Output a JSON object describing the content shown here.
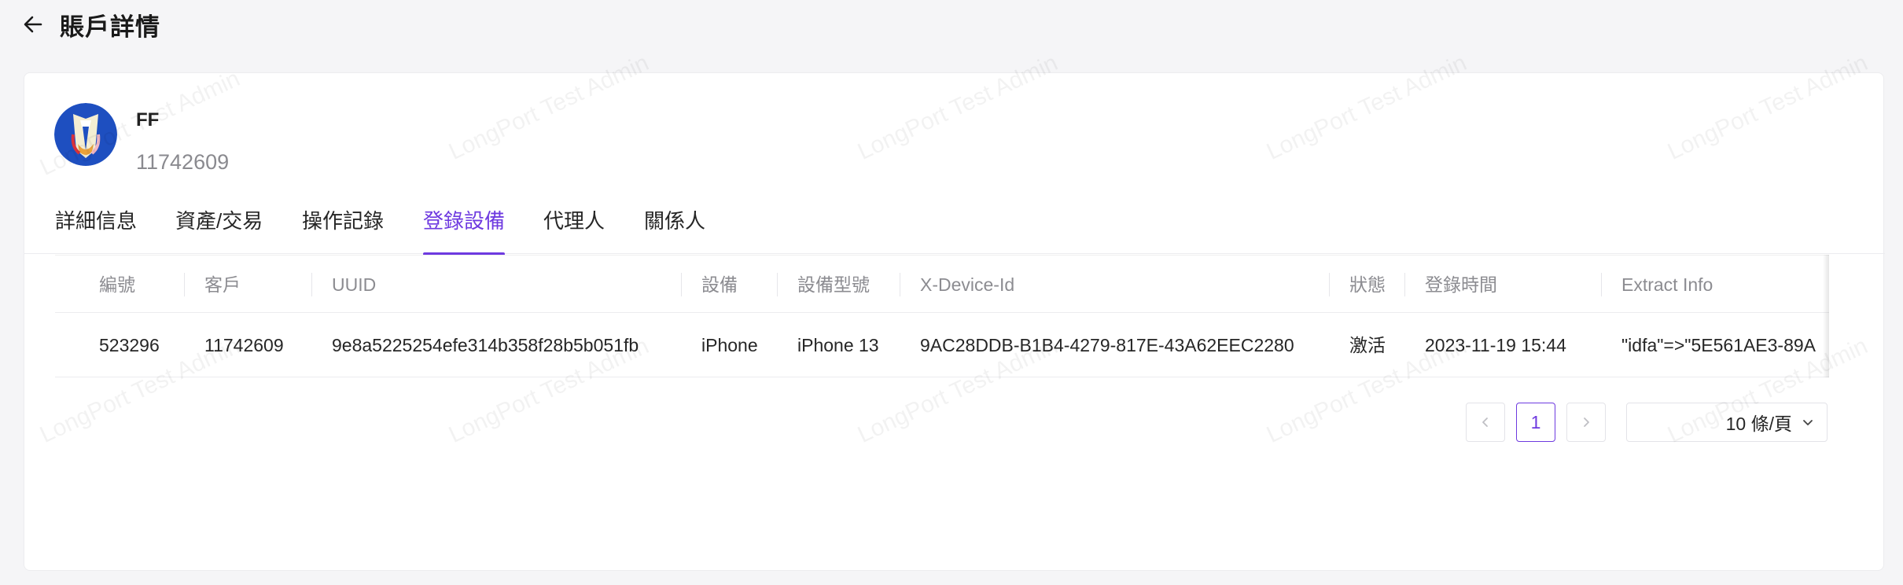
{
  "header": {
    "title": "賬戶詳情"
  },
  "account": {
    "name": "FF",
    "id": "11742609"
  },
  "tabs": [
    {
      "label": "詳細信息",
      "active": false
    },
    {
      "label": "資產/交易",
      "active": false
    },
    {
      "label": "操作記錄",
      "active": false
    },
    {
      "label": "登錄設備",
      "active": true
    },
    {
      "label": "代理人",
      "active": false
    },
    {
      "label": "關係人",
      "active": false
    }
  ],
  "table": {
    "columns": [
      "編號",
      "客戶",
      "UUID",
      "設備",
      "設備型號",
      "X-Device-Id",
      "狀態",
      "登錄時間",
      "Extract Info"
    ],
    "rows": [
      [
        "523296",
        "11742609",
        "9e8a5225254efe314b358f28b5b051fb",
        "iPhone",
        "iPhone 13",
        "9AC28DDB-B1B4-4279-817E-43A62EEC2280",
        "激活",
        "2023-11-19 15:44",
        "\"idfa\"=>\"5E561AE3-89A"
      ]
    ]
  },
  "pagination": {
    "current_page": "1",
    "page_size_label": "10 條/頁"
  },
  "watermark": {
    "text": "LongPort Test Admin"
  },
  "colors": {
    "accent": "#6e3ae0",
    "background": "#f5f5f7"
  }
}
